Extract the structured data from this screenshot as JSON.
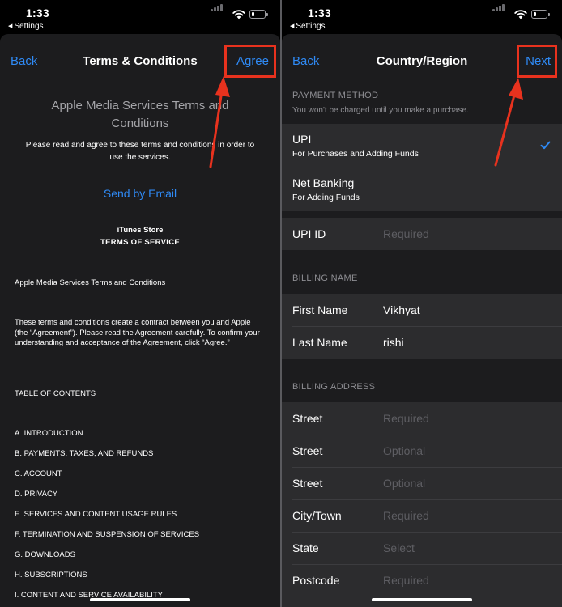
{
  "status": {
    "time": "1:33",
    "back_app": "Settings"
  },
  "left": {
    "nav": {
      "back": "Back",
      "title": "Terms & Conditions",
      "agree": "Agree"
    },
    "terms_title": "Apple Media Services Terms and Conditions",
    "intro": "Please read and agree to these terms and conditions in order to use the services.",
    "send_email": "Send by Email",
    "store_line1": "iTunes Store",
    "store_line2": "TERMS OF SERVICE",
    "doc_heading": "Apple Media Services Terms and Conditions",
    "doc_para": "These terms and conditions create a contract between you and Apple (the “Agreement”). Please read the Agreement carefully. To confirm your understanding and acceptance of the Agreement, click “Agree.”",
    "toc_heading": "TABLE OF CONTENTS",
    "toc": [
      "A. INTRODUCTION",
      "B. PAYMENTS, TAXES, AND REFUNDS",
      "C. ACCOUNT",
      "D. PRIVACY",
      "E. SERVICES AND CONTENT USAGE RULES",
      "F. TERMINATION AND SUSPENSION OF SERVICES",
      "G. DOWNLOADS",
      "H. SUBSCRIPTIONS",
      "I. CONTENT AND SERVICE AVAILABILITY"
    ]
  },
  "right": {
    "nav": {
      "back": "Back",
      "title": "Country/Region",
      "next": "Next"
    },
    "payment_header": "PAYMENT METHOD",
    "payment_sub": "You won't be charged until you make a purchase.",
    "payment_options": [
      {
        "title": "UPI",
        "sub": "For Purchases and Adding Funds",
        "selected": true
      },
      {
        "title": "Net Banking",
        "sub": "For Adding Funds",
        "selected": false
      }
    ],
    "upi": {
      "label": "UPI ID",
      "placeholder": "Required"
    },
    "billing_name_header": "BILLING NAME",
    "billing_name": [
      {
        "label": "First Name",
        "value": "Vikhyat"
      },
      {
        "label": "Last Name",
        "value": "rishi"
      }
    ],
    "billing_address_header": "BILLING ADDRESS",
    "billing_address": [
      {
        "label": "Street",
        "placeholder": "Required"
      },
      {
        "label": "Street",
        "placeholder": "Optional"
      },
      {
        "label": "Street",
        "placeholder": "Optional"
      },
      {
        "label": "City/Town",
        "placeholder": "Required"
      },
      {
        "label": "State",
        "placeholder": "Select"
      },
      {
        "label": "Postcode",
        "placeholder": "Required"
      }
    ]
  },
  "colors": {
    "accent": "#2f8af5",
    "annotation": "#e8321e",
    "background": "#1c1c1e",
    "row": "#2c2c2e"
  },
  "icons": [
    "wifi-icon",
    "battery-icon",
    "signal-icon",
    "checkmark-icon",
    "arrow-annotation-icon"
  ]
}
